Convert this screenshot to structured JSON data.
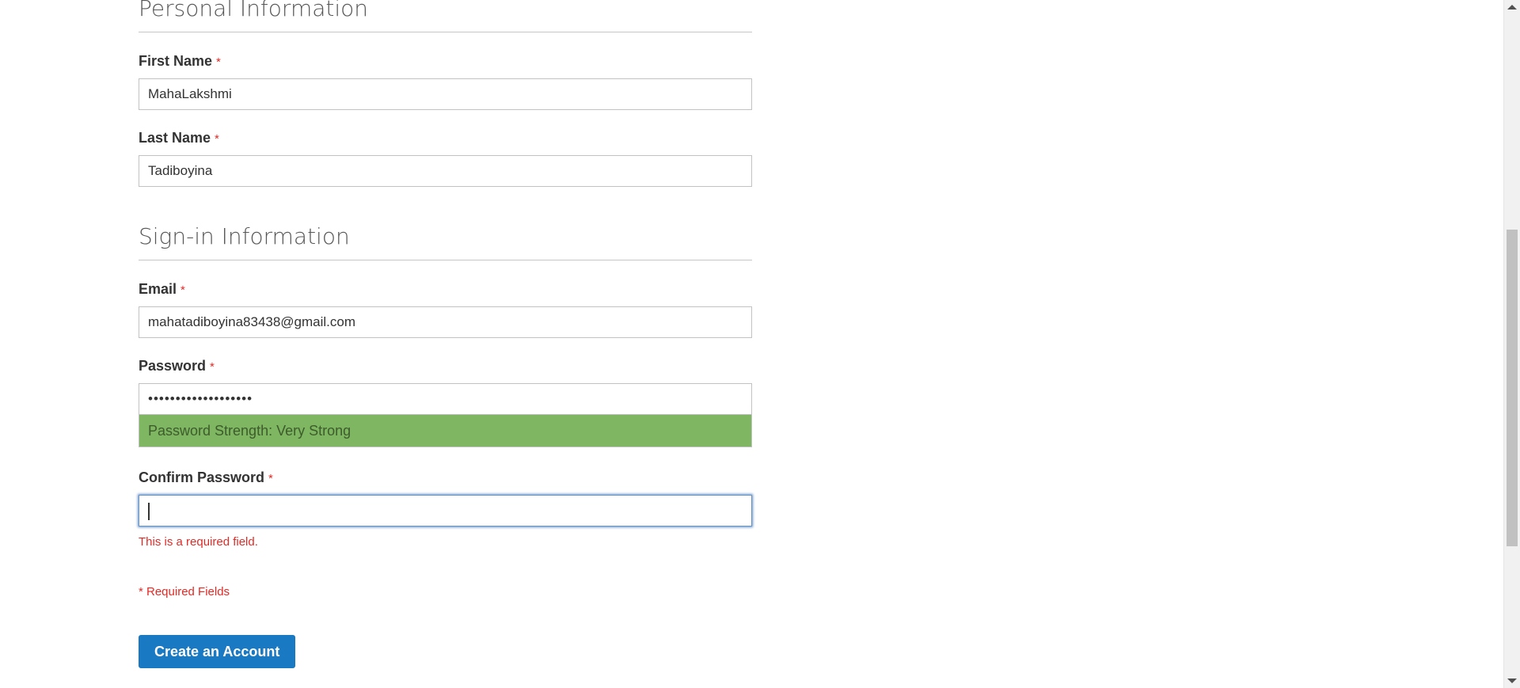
{
  "personal": {
    "title": "Personal Information",
    "first_name": {
      "label": "First Name",
      "value": "MahaLakshmi"
    },
    "last_name": {
      "label": "Last Name",
      "value": "Tadiboyina"
    }
  },
  "signin": {
    "title": "Sign-in Information",
    "email": {
      "label": "Email",
      "value": "mahatadiboyina83438@gmail.com"
    },
    "password": {
      "label": "Password",
      "masked_value": "•••••••••••••••••••",
      "strength_text": "Password Strength: Very Strong"
    },
    "confirm_password": {
      "label": "Confirm Password",
      "value": "",
      "error": "This is a required field."
    }
  },
  "required_marker": "*",
  "required_note": "* Required Fields",
  "submit_label": "Create an Account",
  "colors": {
    "required": "#e02b27",
    "strength_bg": "#7fb662",
    "button": "#1979c3",
    "focus": "#6893c6"
  }
}
